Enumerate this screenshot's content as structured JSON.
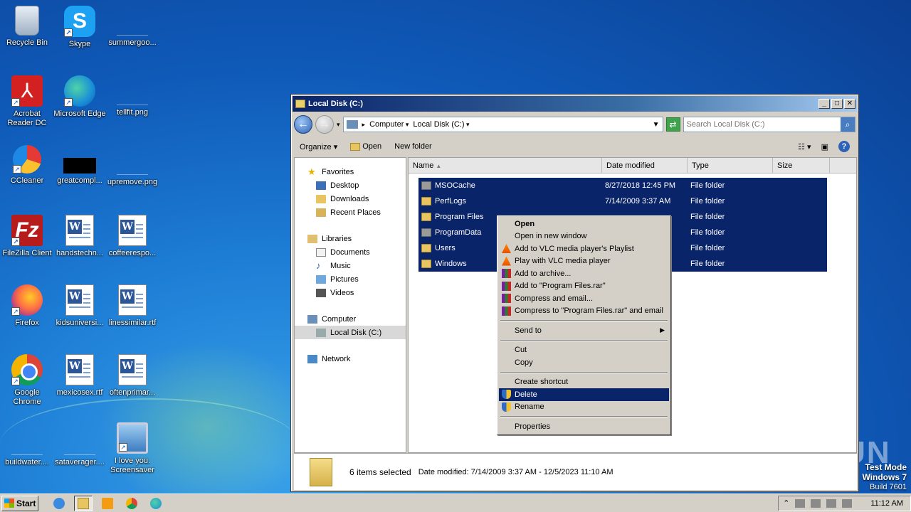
{
  "desktop": {
    "icons": [
      {
        "label": "Recycle Bin",
        "icon": "recycle-bin-icon"
      },
      {
        "label": "Skype",
        "icon": "skype-icon"
      },
      {
        "label": "summergoo...",
        "icon": "blank-file-icon"
      },
      {
        "label": "Acrobat Reader DC",
        "icon": "acrobat-icon"
      },
      {
        "label": "Microsoft Edge",
        "icon": "edge-icon"
      },
      {
        "label": "tellfit.png",
        "icon": "blank-file-icon"
      },
      {
        "label": "CCleaner",
        "icon": "ccleaner-icon"
      },
      {
        "label": "greatcompl...",
        "icon": "black-file-icon"
      },
      {
        "label": "upremove.png",
        "icon": "blank-file-icon"
      },
      {
        "label": "FileZilla Client",
        "icon": "filezilla-icon"
      },
      {
        "label": "handstechn...",
        "icon": "word-doc-icon"
      },
      {
        "label": "coffeerespo...",
        "icon": "word-doc-icon"
      },
      {
        "label": "Firefox",
        "icon": "firefox-icon"
      },
      {
        "label": "kidsuniversi...",
        "icon": "word-doc-icon"
      },
      {
        "label": "linessimilar.rtf",
        "icon": "word-doc-icon"
      },
      {
        "label": "Google Chrome",
        "icon": "chrome-icon"
      },
      {
        "label": "mexicosex.rtf",
        "icon": "word-doc-icon"
      },
      {
        "label": "oftenprimar...",
        "icon": "word-doc-icon"
      },
      {
        "label": "buildwater....",
        "icon": "blank-file-icon"
      },
      {
        "label": "sataverager....",
        "icon": "blank-file-icon"
      },
      {
        "label": "I love you. Screensaver",
        "icon": "screensaver-icon"
      }
    ]
  },
  "window": {
    "title": "Local Disk (C:)",
    "buttons": {
      "minimize": "_",
      "maximize": "□",
      "close": "✕"
    },
    "address": {
      "crumbs": [
        "Computer",
        "Local Disk (C:)"
      ]
    },
    "search": {
      "placeholder": "Search Local Disk (C:)"
    },
    "toolbar": {
      "organize": "Organize",
      "open": "Open",
      "new_folder": "New folder"
    },
    "nav": {
      "favorites": "Favorites",
      "desktop": "Desktop",
      "downloads": "Downloads",
      "recent": "Recent Places",
      "libraries": "Libraries",
      "documents": "Documents",
      "music": "Music",
      "pictures": "Pictures",
      "videos": "Videos",
      "computer": "Computer",
      "local_disk": "Local Disk (C:)",
      "network": "Network"
    },
    "columns": {
      "name": "Name",
      "date": "Date modified",
      "type": "Type",
      "size": "Size"
    },
    "rows": [
      {
        "name": "MSOCache",
        "date": "8/27/2018 12:45 PM",
        "type": "File folder"
      },
      {
        "name": "PerfLogs",
        "date": "7/14/2009 3:37 AM",
        "type": "File folder"
      },
      {
        "name": "Program Files",
        "date": "",
        "type": "File folder"
      },
      {
        "name": "ProgramData",
        "date": "",
        "type": "File folder"
      },
      {
        "name": "Users",
        "date": "",
        "type": "File folder"
      },
      {
        "name": "Windows",
        "date": "",
        "type": "File folder"
      }
    ],
    "details": {
      "count": "6 items selected",
      "date_modified": "Date modified: 7/14/2009 3:37 AM - 12/5/2023 11:10 AM"
    }
  },
  "context_menu": {
    "items": [
      "Open",
      "Open in new window",
      "Add to VLC media player's Playlist",
      "Play with VLC media player",
      "Add to archive...",
      "Add to \"Program Files.rar\"",
      "Compress and email...",
      "Compress to \"Program Files.rar\" and email",
      "Send to",
      "Cut",
      "Copy",
      "Create shortcut",
      "Delete",
      "Rename",
      "Properties"
    ]
  },
  "taskbar": {
    "start": "Start",
    "clock": "11:12 AM"
  },
  "watermark": {
    "line1": "Test Mode",
    "line2": "Windows 7",
    "line3": "Build 7601",
    "brand": "ANY RUN"
  }
}
